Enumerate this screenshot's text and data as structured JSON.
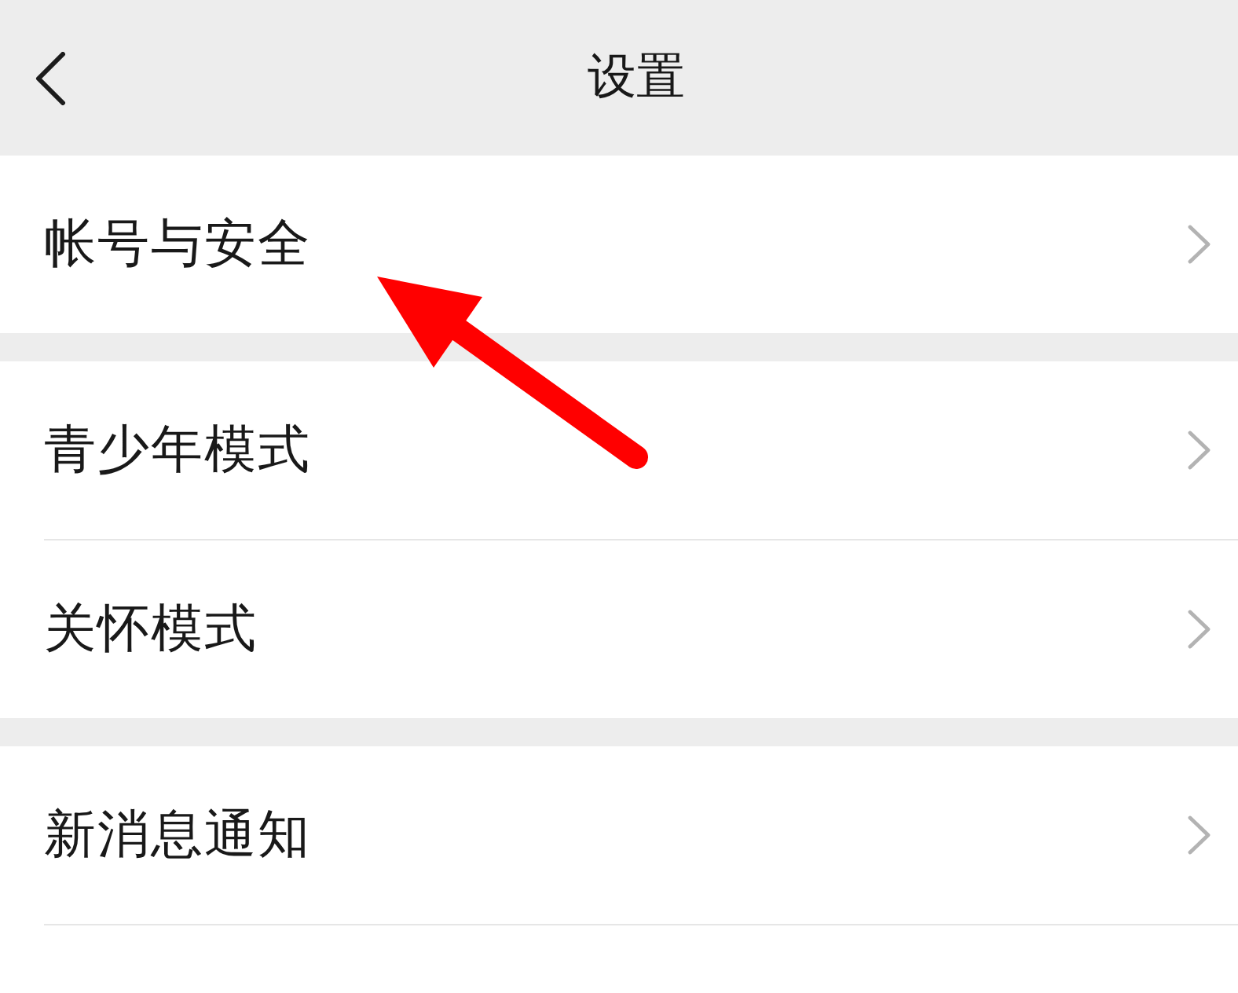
{
  "header": {
    "title": "设置"
  },
  "groups": [
    {
      "items": [
        {
          "label": "帐号与安全"
        }
      ]
    },
    {
      "items": [
        {
          "label": "青少年模式"
        },
        {
          "label": "关怀模式"
        }
      ]
    },
    {
      "items": [
        {
          "label": "新消息通知"
        }
      ]
    }
  ]
}
